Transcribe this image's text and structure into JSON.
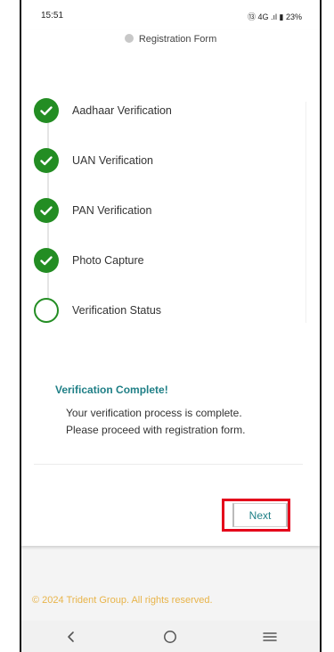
{
  "status_bar": {
    "time": "15:51",
    "indicators": "⑬ 4G .ıl ▮ 23%"
  },
  "header": {
    "title": "Registration Form"
  },
  "steps": [
    {
      "label": "Aadhaar Verification",
      "state": "done"
    },
    {
      "label": "UAN Verification",
      "state": "done"
    },
    {
      "label": "PAN Verification",
      "state": "done"
    },
    {
      "label": "Photo Capture",
      "state": "done"
    },
    {
      "label": "Verification Status",
      "state": "pending"
    }
  ],
  "completion": {
    "title": "Verification Complete!",
    "line1": "Your verification process is complete.",
    "line2": "Please proceed with registration form."
  },
  "actions": {
    "next_label": "Next"
  },
  "footer": {
    "copyright": "© 2024 Trident Group. All rights reserved."
  },
  "icons": {
    "done_step": "check-icon",
    "pending_step": "empty-circle-icon",
    "nav": [
      "back-icon",
      "home-icon",
      "recent-apps-icon"
    ]
  },
  "colors": {
    "success_green": "#238d23",
    "accent_teal": "#1f7f86",
    "highlight_red": "#e4001b",
    "footer_gold": "#e8b44a"
  }
}
